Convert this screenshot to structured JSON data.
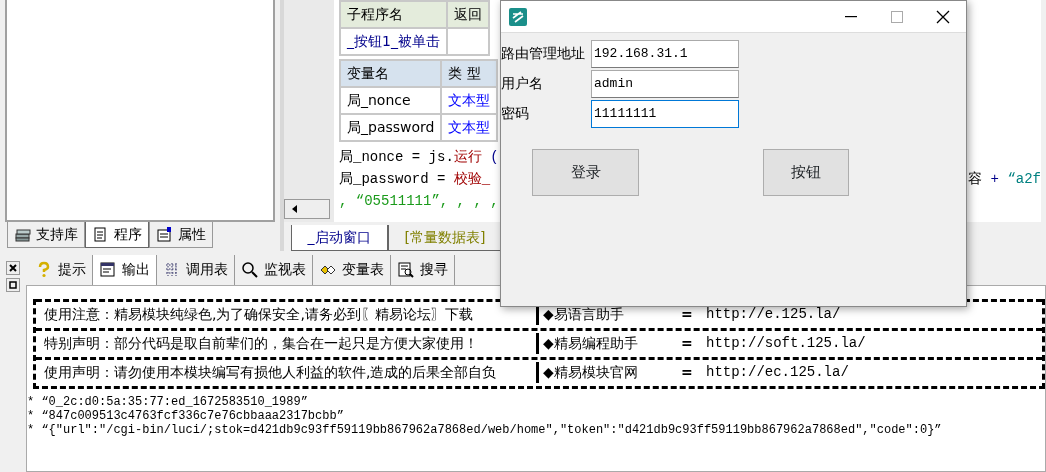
{
  "left_panel": {
    "tabs": [
      {
        "label": "支持库",
        "selected": false
      },
      {
        "label": "程序",
        "selected": true
      },
      {
        "label": "属性",
        "selected": false
      }
    ]
  },
  "editor": {
    "sub_table": {
      "columns": [
        "子程序名",
        "返回"
      ],
      "rows": [
        {
          "name": "_按钮1_被单击"
        }
      ]
    },
    "var_table": {
      "columns": [
        "变量名",
        "类 型"
      ],
      "rows": [
        {
          "name": "局_nonce",
          "type": "文本型"
        },
        {
          "name": "局_password",
          "type": "文本型"
        }
      ]
    },
    "code_lines": [
      {
        "left": [
          {
            "kind": "plain",
            "text": "局_nonce = js."
          },
          {
            "kind": "keyword",
            "text": "运行"
          },
          {
            "kind": "operator",
            "text": " ("
          }
        ]
      },
      {
        "left": [
          {
            "kind": "plain",
            "text": "局_password = "
          },
          {
            "kind": "keyword",
            "text": "校验_"
          }
        ],
        "right": [
          {
            "kind": "plain",
            "text": "容"
          },
          {
            "kind": "operator",
            "text": " + "
          },
          {
            "kind": "string",
            "text": "“a2f"
          }
        ]
      },
      {
        "left": [
          {
            "kind": "string",
            "text": ", “05511111”, , , ,"
          }
        ]
      }
    ],
    "tabs": [
      {
        "label": "_启动窗口",
        "selected": true
      },
      {
        "label": "[常量数据表]",
        "selected": false
      }
    ]
  },
  "bottom_panel": {
    "tabs": [
      {
        "label": "提示",
        "selected": false
      },
      {
        "label": "输出",
        "selected": true
      },
      {
        "label": "调用表",
        "selected": false
      },
      {
        "label": "监视表",
        "selected": false
      },
      {
        "label": "变量表",
        "selected": false
      },
      {
        "label": "搜寻",
        "selected": false
      }
    ],
    "notice_rows": [
      {
        "text": "使用注意：精易模块纯绿色,为了确保安全,请务必到〖精易论坛〗下载",
        "site": "◆易语言助手",
        "equals": "=",
        "url": "http://e.125.la/"
      },
      {
        "text": "特别声明：部分代码是取自前辈们的，集合在一起只是方便大家使用！",
        "site": "◆精易编程助手",
        "equals": "=",
        "url": "http://soft.125.la/"
      },
      {
        "text": "使用声明：请勿使用本模块编写有损他人利益的软件,造成的后果全部自负",
        "site": "◆精易模块官网",
        "equals": "=",
        "url": "http://ec.125.la/"
      }
    ],
    "output_lines": [
      "* “0_2c:d0:5a:35:77:ed_1672583510_1989”",
      "* “847c009513c4763fcf336c7e76cbbaaa2317bcbb”",
      "* “{\"url\":\"/cgi-bin/luci/;stok=d421db9c93ff59119bb867962a7868ed/web/home\",\"token\":\"d421db9c93ff59119bb867962a7868ed\",\"code\":0}”"
    ]
  },
  "dialog": {
    "fields": [
      {
        "label": "路由管理地址",
        "value": "192.168.31.1",
        "focused": false
      },
      {
        "label": "用户名",
        "value": "admin",
        "focused": false
      },
      {
        "label": "密码",
        "value": "11111111",
        "focused": true
      }
    ],
    "buttons": [
      "登录",
      "按钮"
    ]
  }
}
